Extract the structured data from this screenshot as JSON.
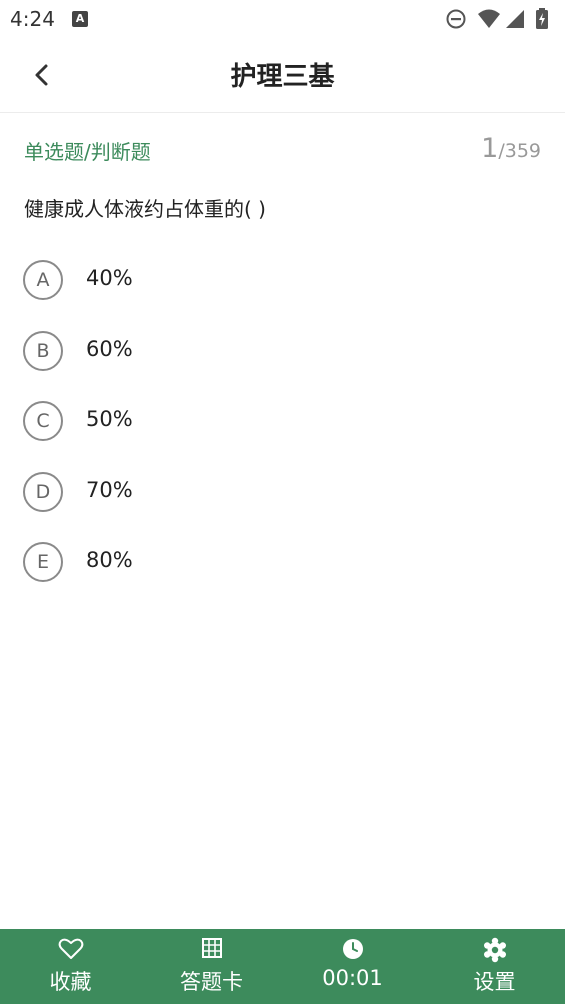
{
  "status_bar": {
    "time": "4:24",
    "notif_letter": "A"
  },
  "header": {
    "title": "护理三基"
  },
  "question": {
    "type": "单选题/判断题",
    "current": "1",
    "total": "/359",
    "text": "健康成人体液约占体重的( )",
    "options": [
      {
        "letter": "A",
        "text": "40%"
      },
      {
        "letter": "B",
        "text": "60%"
      },
      {
        "letter": "C",
        "text": "50%"
      },
      {
        "letter": "D",
        "text": "70%"
      },
      {
        "letter": "E",
        "text": "80%"
      }
    ]
  },
  "bottom_bar": {
    "favorite_label": "收藏",
    "answer_card_label": "答题卡",
    "timer": "00:01",
    "settings_label": "设置",
    "background": "#3d8b5c"
  },
  "colors": {
    "accent_green": "#3d8b5c",
    "option_border": "#8a8a8a"
  }
}
